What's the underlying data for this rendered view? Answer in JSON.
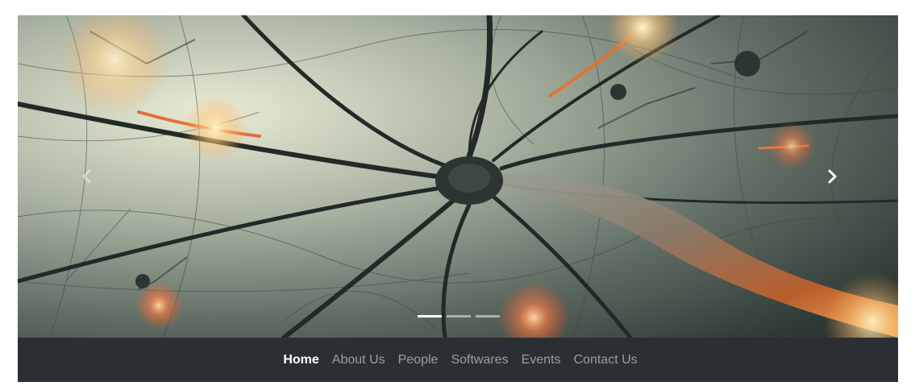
{
  "carousel": {
    "image": "neuron-network-image",
    "prev_icon": "chevron-left-icon",
    "next_icon": "chevron-right-icon",
    "slide_count": 3,
    "active_slide": 1
  },
  "navbar": {
    "items": [
      {
        "label": "Home",
        "active": true
      },
      {
        "label": "About Us",
        "active": false
      },
      {
        "label": "People",
        "active": false
      },
      {
        "label": "Softwares",
        "active": false
      },
      {
        "label": "Events",
        "active": false
      },
      {
        "label": "Contact Us",
        "active": false
      }
    ]
  },
  "colors": {
    "navbar_bg": "#2b2f33",
    "nav_link": "#9a9da1",
    "nav_link_active": "#ffffff"
  }
}
